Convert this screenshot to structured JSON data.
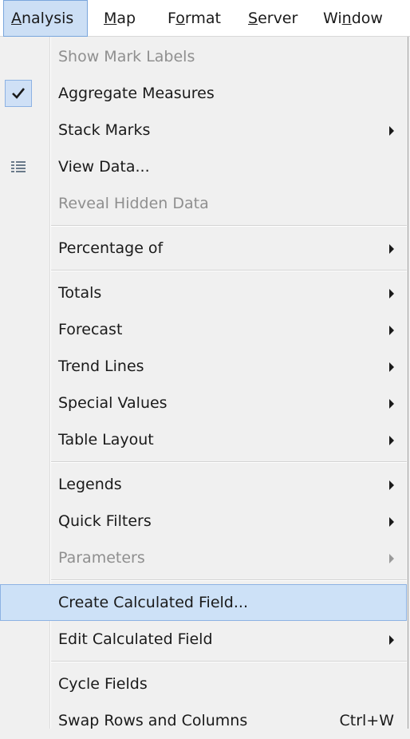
{
  "menubar": {
    "items": [
      {
        "pre": "",
        "u": "A",
        "post": "nalysis"
      },
      {
        "pre": "",
        "u": "M",
        "post": "ap"
      },
      {
        "pre": "F",
        "u": "o",
        "post": "rmat"
      },
      {
        "pre": "",
        "u": "S",
        "post": "erver"
      },
      {
        "pre": "Wi",
        "u": "n",
        "post": "dow"
      }
    ]
  },
  "menu": {
    "items": [
      {
        "label": "Show Mark Labels"
      },
      {
        "label": "Aggregate Measures",
        "icon": "checkmark-icon"
      },
      {
        "label": "Stack Marks"
      },
      {
        "label": "View Data...",
        "icon": "data-grid-icon"
      },
      {
        "label": "Reveal Hidden Data"
      },
      {
        "label": "Percentage of"
      },
      {
        "label": "Totals"
      },
      {
        "label": "Forecast"
      },
      {
        "label": "Trend Lines"
      },
      {
        "label": "Special Values"
      },
      {
        "label": "Table Layout"
      },
      {
        "label": "Legends"
      },
      {
        "label": "Quick Filters"
      },
      {
        "label": "Parameters"
      },
      {
        "label": "Create Calculated Field..."
      },
      {
        "label": "Edit Calculated Field"
      },
      {
        "label": "Cycle Fields"
      },
      {
        "label": "Swap Rows and Columns",
        "shortcut": "Ctrl+W"
      }
    ]
  },
  "colors": {
    "highlight": "#cde1f7",
    "highlight_border": "#8db2e3",
    "disabled_text": "#8f8f8f"
  }
}
